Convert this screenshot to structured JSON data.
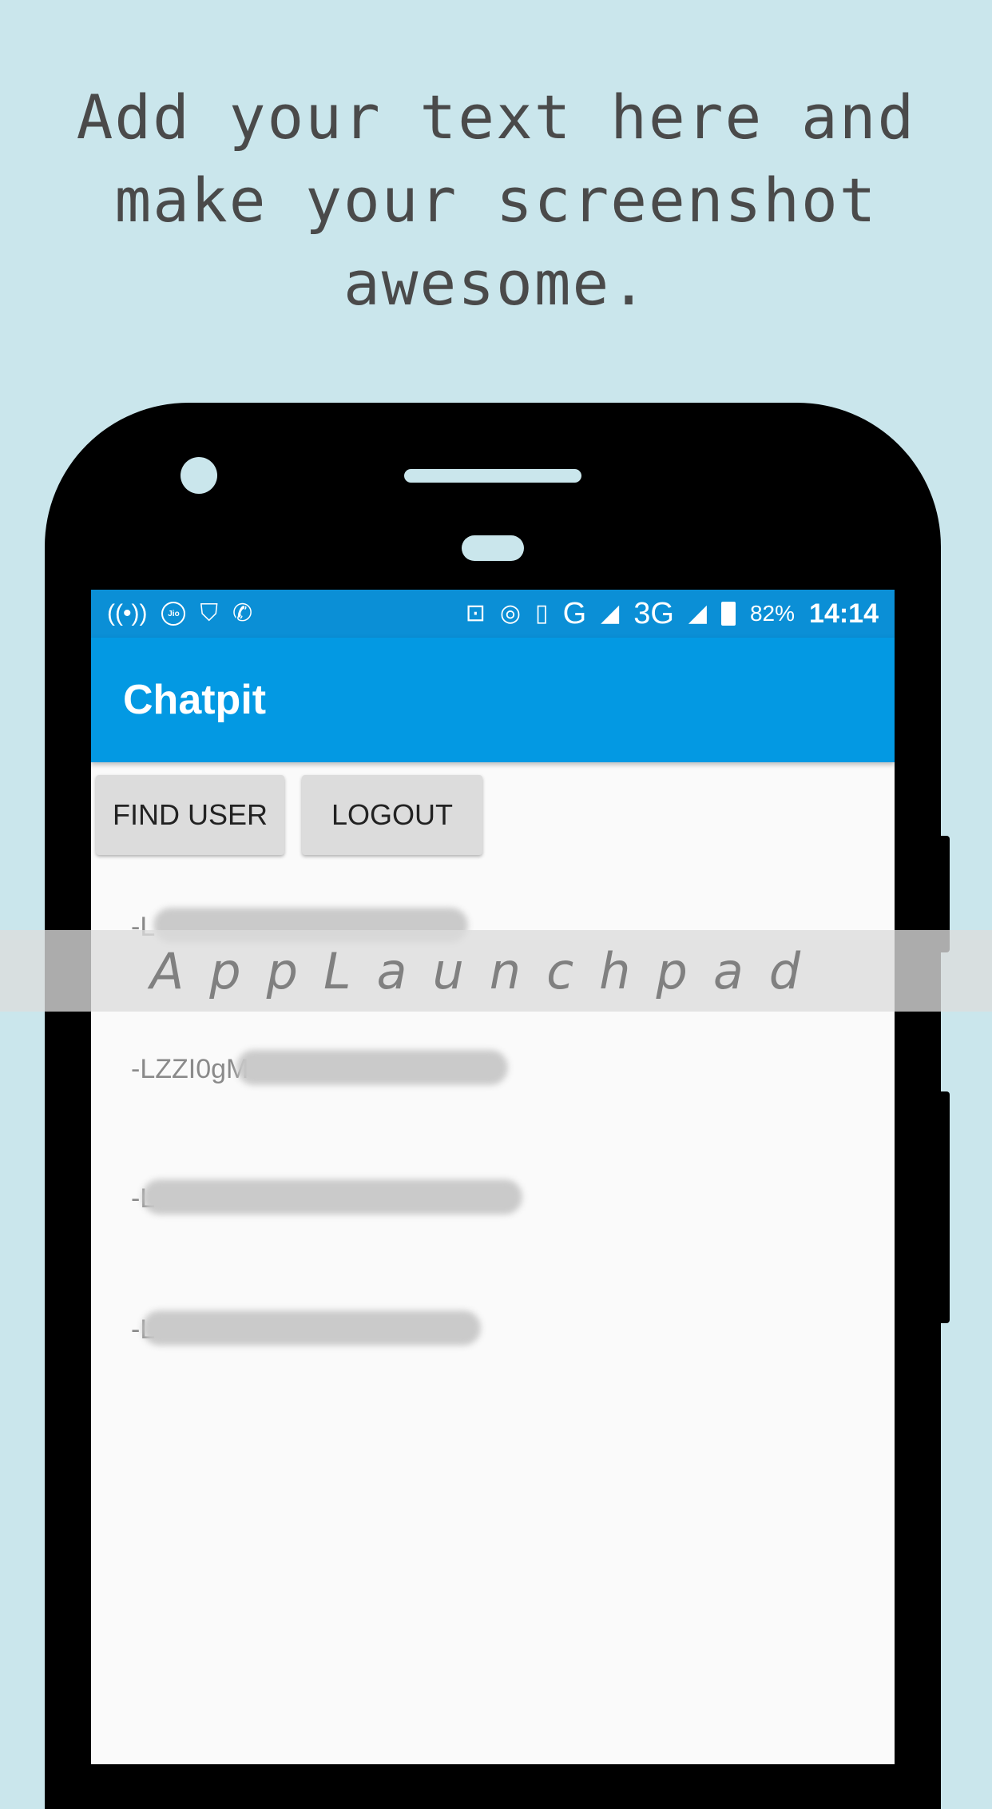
{
  "headline": {
    "line1": "Add your text here and",
    "line2": "make your screenshot",
    "line3": "awesome."
  },
  "status_bar": {
    "battery_percent": "82%",
    "time": "14:14",
    "network_1": "G",
    "network_2": "3G",
    "carrier_badge": "Jio"
  },
  "app_bar": {
    "title": "Chatpit"
  },
  "buttons": {
    "find_user": "FIND USER",
    "logout": "LOGOUT"
  },
  "users": [
    {
      "visible_text": "-L"
    },
    {
      "visible_text": "-LZZI0gM"
    },
    {
      "visible_text": "-L"
    },
    {
      "visible_text": "-L"
    }
  ],
  "watermark": {
    "text": "AppLaunchpad"
  },
  "colors": {
    "background": "#cae6ec",
    "status_bar": "#0b8fd6",
    "app_bar": "#0399e3",
    "button": "#dcdcdc"
  }
}
